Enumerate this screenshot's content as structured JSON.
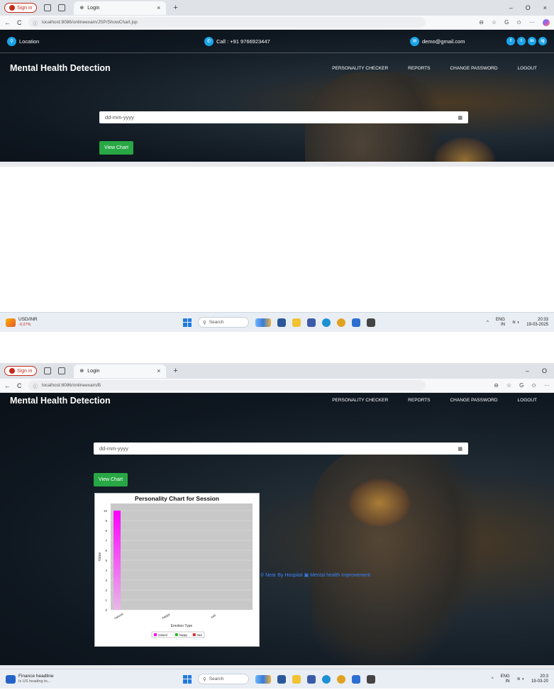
{
  "browser": {
    "profile_label": "Sign in",
    "tab_title": "Login",
    "tab_close": "×",
    "new_tab": "+",
    "back": "←",
    "refresh": "C",
    "url_top": "localhost:8086/onlineexam/JSP/ShowChart.jsp",
    "url_host_top": "localhost",
    "url_bottom": "localhost:8086/onlineexam/B",
    "minimize": "–",
    "maximize": "O",
    "close": "×"
  },
  "site": {
    "location_label": "Location",
    "phone_label": "Call : +91 9766923447",
    "email_label": "demo@gmail.com",
    "brand": "Mental Health Detection",
    "nav": [
      "PERSONALITY CHECKER",
      "REPORTS",
      "CHANGE PASSWORD",
      "LOGOUT"
    ],
    "date_placeholder": "dd-mm-yyyy",
    "view_chart_label": "View Chart",
    "footer_text": "Near By Hospital",
    "footer_text2": "Mental health Improvement",
    "social": [
      "f",
      "t",
      "in",
      "ig"
    ]
  },
  "taskbar_top": {
    "widget_title": "USD/INR",
    "widget_sub": "-0.27%",
    "search": "Search",
    "lang_top": "ENG",
    "lang_bottom": "IN",
    "time": "20:33",
    "date": "19-03-2025"
  },
  "taskbar_bottom": {
    "widget_title": "Finance headline",
    "widget_sub": "Is US heading to...",
    "search": "Search",
    "lang_top": "ENG",
    "lang_bottom": "IN",
    "time": "20:3",
    "date": "19-03-20"
  },
  "chart_data": {
    "type": "bar",
    "title": "Personality Chart for Session",
    "xlabel": "Emotion Type",
    "ylabel": "Value",
    "categories": [
      "natural",
      "happy",
      "sad"
    ],
    "series": [
      {
        "name": "natural",
        "values": [
          10,
          0,
          0
        ],
        "color": "#ff00ff"
      },
      {
        "name": "happy",
        "values": [
          0,
          0,
          0
        ],
        "color": "#22bb22"
      },
      {
        "name": "sad",
        "values": [
          0,
          0,
          0
        ],
        "color": "#e03030"
      }
    ],
    "ylim": [
      0,
      10
    ],
    "yticks": [
      0,
      1,
      2,
      3,
      4,
      5,
      6,
      7,
      8,
      9,
      10
    ],
    "grid": true,
    "legend": "bottom"
  },
  "colors": {
    "accent_blue": "#1aa3e8",
    "button_green": "#28a745",
    "bar_magenta": "#ff00ff"
  }
}
